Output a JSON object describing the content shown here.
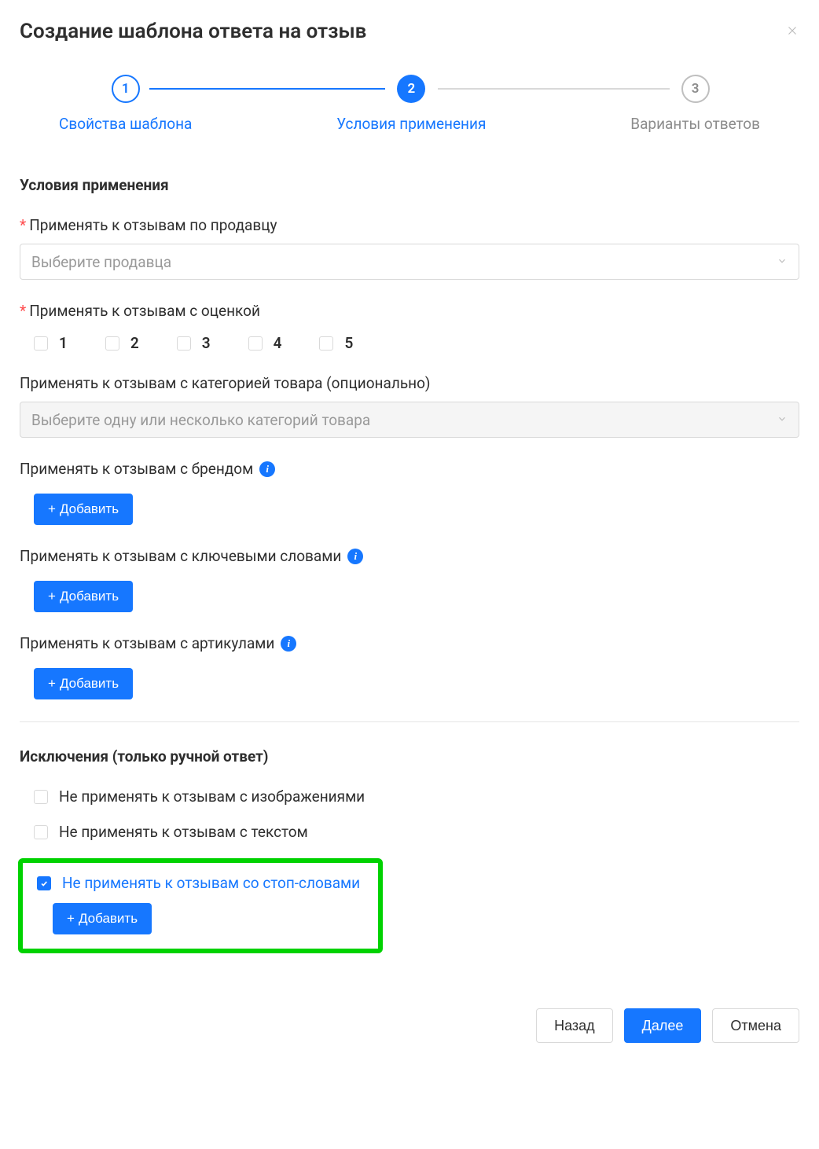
{
  "header": {
    "title": "Создание шаблона ответа на отзыв"
  },
  "steps": [
    {
      "num": "1",
      "label": "Свойства шаблона"
    },
    {
      "num": "2",
      "label": "Условия применения"
    },
    {
      "num": "3",
      "label": "Варианты ответов"
    }
  ],
  "section_conditions_title": "Условия применения",
  "seller_field": {
    "label": "Применять к отзывам по продавцу",
    "placeholder": "Выберите продавца"
  },
  "rating_field": {
    "label": "Применять к отзывам с оценкой",
    "options": [
      "1",
      "2",
      "3",
      "4",
      "5"
    ]
  },
  "category_field": {
    "label": "Применять к отзывам с категорией товара (опционально)",
    "placeholder": "Выберите одну или несколько категорий товара"
  },
  "brand_field": {
    "label": "Применять к отзывам с брендом",
    "add": "Добавить"
  },
  "keywords_field": {
    "label": "Применять к отзывам с ключевыми словами",
    "add": "Добавить"
  },
  "articles_field": {
    "label": "Применять к отзывам с артикулами",
    "add": "Добавить"
  },
  "exclusions_title": "Исключения (только ручной ответ)",
  "exclusion_images": "Не применять к отзывам с изображениями",
  "exclusion_text": "Не применять к отзывам с текстом",
  "exclusion_stopwords": {
    "label": "Не применять к отзывам со стоп-словами",
    "add": "Добавить"
  },
  "footer": {
    "back": "Назад",
    "next": "Далее",
    "cancel": "Отмена"
  }
}
